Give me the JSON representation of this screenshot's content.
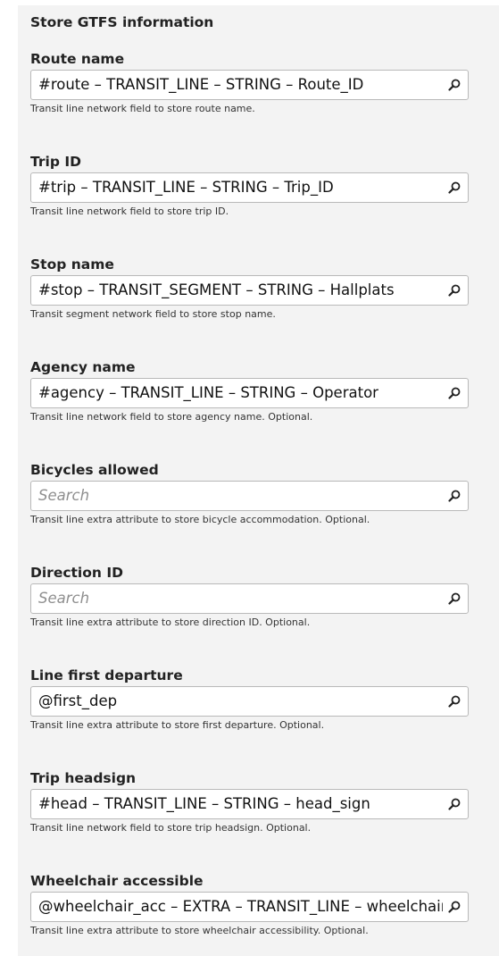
{
  "section_title": "Store GTFS information",
  "fields": [
    {
      "label": "Route name",
      "value": "#route – TRANSIT_LINE – STRING – Route_ID",
      "placeholder": "",
      "help": "Transit line network field to store route name."
    },
    {
      "label": "Trip ID",
      "value": "#trip – TRANSIT_LINE – STRING – Trip_ID",
      "placeholder": "",
      "help": "Transit line network field to store trip ID."
    },
    {
      "label": "Stop name",
      "value": "#stop – TRANSIT_SEGMENT – STRING – Hallplats",
      "placeholder": "",
      "help": "Transit segment network field to store stop name."
    },
    {
      "label": "Agency name",
      "value": "#agency – TRANSIT_LINE – STRING – Operator",
      "placeholder": "",
      "help": "Transit line network field to store agency name. Optional."
    },
    {
      "label": "Bicycles allowed",
      "value": "",
      "placeholder": "Search",
      "help": "Transit line extra attribute to store bicycle accommodation. Optional."
    },
    {
      "label": "Direction ID",
      "value": "",
      "placeholder": "Search",
      "help": "Transit line extra attribute to store direction ID. Optional."
    },
    {
      "label": "Line first departure",
      "value": "@first_dep",
      "placeholder": "",
      "help": "Transit line extra attribute to store first departure. Optional."
    },
    {
      "label": "Trip headsign",
      "value": "#head – TRANSIT_LINE – STRING – head_sign",
      "placeholder": "",
      "help": "Transit line network field to store trip headsign. Optional."
    },
    {
      "label": "Wheelchair accessible",
      "value": "@wheelchair_acc – EXTRA – TRANSIT_LINE – wheelchair_accessible",
      "placeholder": "",
      "help": "Transit line extra attribute to store wheelchair accessibility. Optional."
    }
  ],
  "icons": {
    "search": "search-icon"
  }
}
